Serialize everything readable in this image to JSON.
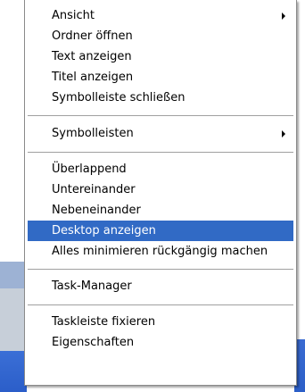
{
  "menu": {
    "group1": {
      "ansicht": "Ansicht",
      "ordner_oeffnen": "Ordner öffnen",
      "text_anzeigen": "Text anzeigen",
      "titel_anzeigen": "Titel anzeigen",
      "symbolleiste_schliessen": "Symbolleiste schließen"
    },
    "group2": {
      "symbolleisten": "Symbolleisten"
    },
    "group3": {
      "ueberlappend": "Überlappend",
      "untereinander": "Untereinander",
      "nebeneinander": "Nebeneinander",
      "desktop_anzeigen": "Desktop anzeigen",
      "alles_minimieren_rueckgaengig": "Alles minimieren rückgängig machen"
    },
    "group4": {
      "task_manager": "Task-Manager"
    },
    "group5": {
      "taskleiste_fixieren": "Taskleiste fixieren",
      "eigenschaften": "Eigenschaften"
    }
  },
  "colors": {
    "highlight": "#316ac5",
    "taskbar_blue": "#2c5fc8"
  },
  "icons": {
    "submenu_arrow": "triangle-right"
  }
}
